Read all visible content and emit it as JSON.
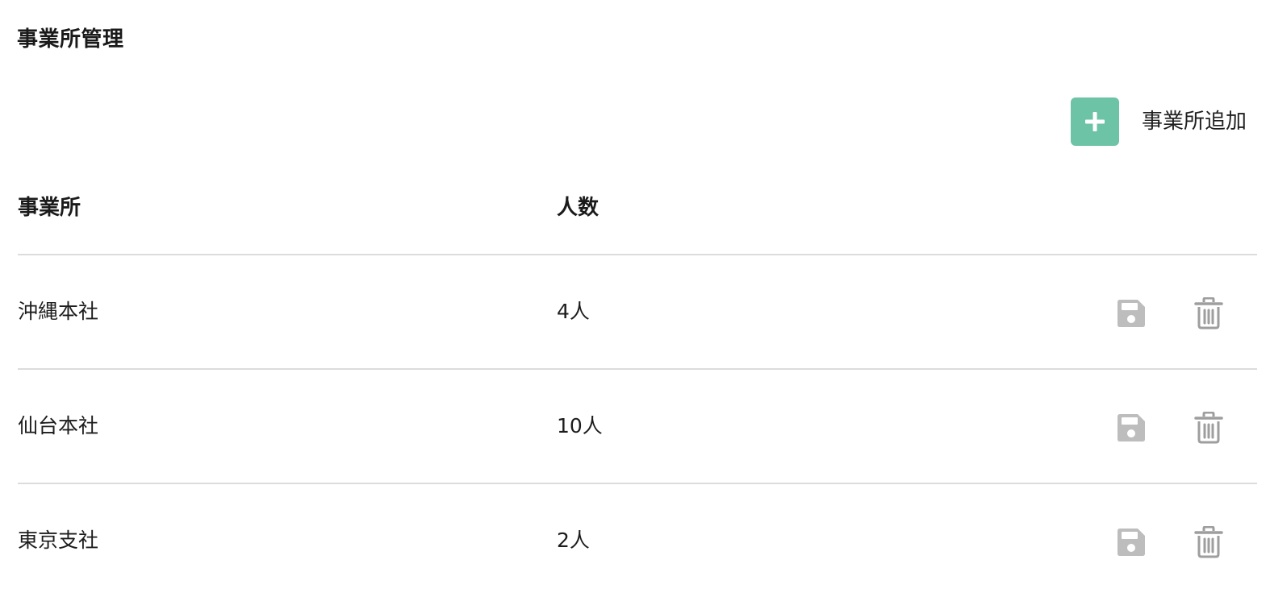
{
  "page": {
    "title": "事業所管理"
  },
  "toolbar": {
    "add_label": "事業所追加",
    "add_icon": "plus-icon",
    "accent_color": "#6cc3a6"
  },
  "table": {
    "headers": {
      "name": "事業所",
      "count": "人数"
    },
    "rows": [
      {
        "name": "沖縄本社",
        "count": "4人"
      },
      {
        "name": "仙台本社",
        "count": "10人"
      },
      {
        "name": "東京支社",
        "count": "2人"
      }
    ],
    "row_icons": {
      "save": "save-icon",
      "delete": "trash-icon"
    },
    "icon_colors": {
      "save": "#bdbdbd",
      "delete": "#9e9e9e"
    }
  }
}
